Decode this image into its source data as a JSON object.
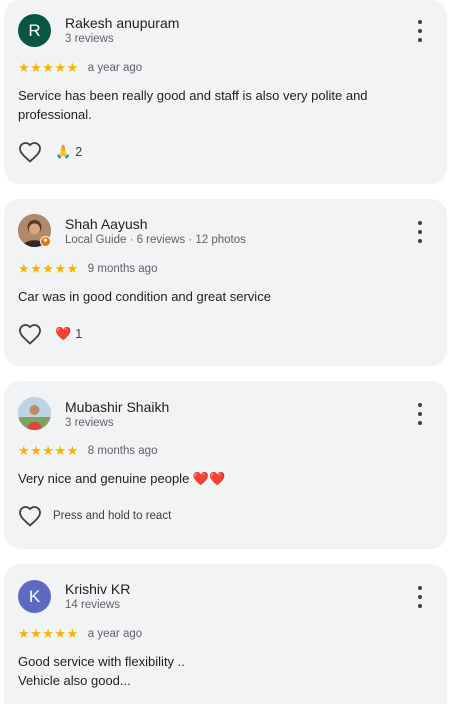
{
  "reviews": [
    {
      "initial": "R",
      "avatar_color": "#0b5545",
      "name": "Rakesh anupuram",
      "meta": "3 reviews",
      "stars": "★★★★★",
      "date": "a year ago",
      "text": "Service has been really good and staff is also very polite and professional.",
      "reaction_emoji": "🙏",
      "reaction_count": "2"
    },
    {
      "name": "Shah Aayush",
      "meta": "Local Guide · 6 reviews · 12 photos",
      "stars": "★★★★★",
      "date": "9 months ago",
      "text": "Car was in good condition and great service",
      "reaction_emoji": "❤️",
      "reaction_count": "1"
    },
    {
      "name": "Mubashir Shaikh",
      "meta": "3 reviews",
      "stars": "★★★★★",
      "date": "8 months ago",
      "text": "Very nice and genuine people ❤️❤️",
      "react_hint": "Press and hold to react"
    },
    {
      "initial": "K",
      "avatar_color": "#5c6bc0",
      "name": "Krishiv KR",
      "meta": "14 reviews",
      "stars": "★★★★★",
      "date": "a year ago",
      "text_line1": "Good service with flexibility ..",
      "text_line2": "Vehicle also good..."
    }
  ]
}
